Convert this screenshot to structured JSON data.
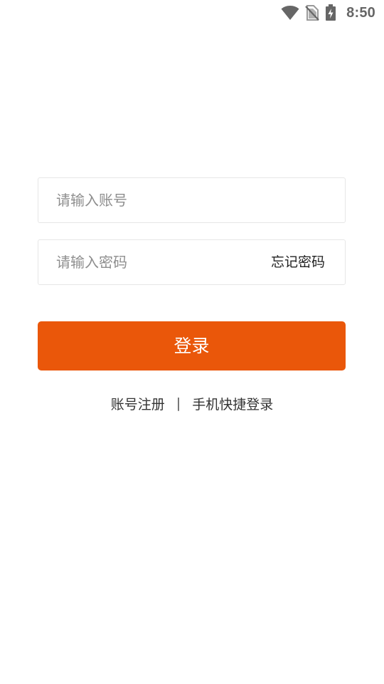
{
  "status_bar": {
    "time": "8:50",
    "icons": [
      "wifi-icon",
      "no-sim-icon",
      "battery-charging-icon"
    ]
  },
  "login_form": {
    "account_placeholder": "请输入账号",
    "account_value": "",
    "password_placeholder": "请输入密码",
    "password_value": "",
    "forgot_password_label": "忘记密码",
    "login_button_label": "登录"
  },
  "footer_links": {
    "register_label": "账号注册",
    "separator": "|",
    "phone_login_label": "手机快捷登录"
  },
  "colors": {
    "accent": "#ea570a",
    "background": "#ffffff",
    "border": "#e6e6e6",
    "placeholder": "#8e8e8e",
    "text": "#333333"
  }
}
